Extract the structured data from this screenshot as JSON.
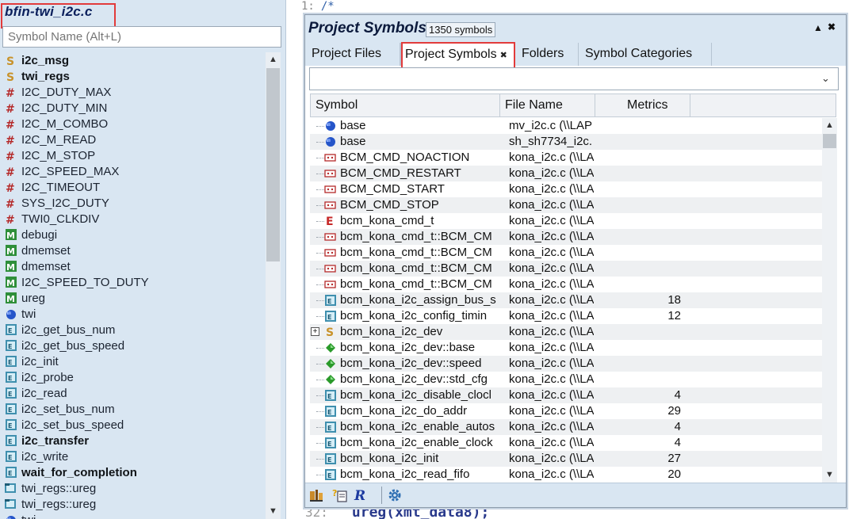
{
  "left": {
    "file_title": "bfin-twi_i2c.c",
    "search_placeholder": "Symbol Name (Alt+L)",
    "items": [
      {
        "label": "i2c_msg",
        "icon": "struct-icon",
        "bold": true
      },
      {
        "label": "twi_regs",
        "icon": "struct-icon",
        "bold": true
      },
      {
        "label": "I2C_DUTY_MAX",
        "icon": "macro-constant-icon",
        "bold": false
      },
      {
        "label": "I2C_DUTY_MIN",
        "icon": "macro-constant-icon",
        "bold": false
      },
      {
        "label": "I2C_M_COMBO",
        "icon": "macro-constant-icon",
        "bold": false
      },
      {
        "label": "I2C_M_READ",
        "icon": "macro-constant-icon",
        "bold": false
      },
      {
        "label": "I2C_M_STOP",
        "icon": "macro-constant-icon",
        "bold": false
      },
      {
        "label": "I2C_SPEED_MAX",
        "icon": "macro-constant-icon",
        "bold": false
      },
      {
        "label": "I2C_TIMEOUT",
        "icon": "macro-constant-icon",
        "bold": false
      },
      {
        "label": "SYS_I2C_DUTY",
        "icon": "macro-constant-icon",
        "bold": false
      },
      {
        "label": "TWI0_CLKDIV",
        "icon": "macro-constant-icon",
        "bold": false
      },
      {
        "label": "debugi",
        "icon": "macro-function-icon",
        "bold": false
      },
      {
        "label": "dmemset",
        "icon": "macro-function-icon",
        "bold": false
      },
      {
        "label": "dmemset",
        "icon": "macro-function-icon",
        "bold": false
      },
      {
        "label": "I2C_SPEED_TO_DUTY",
        "icon": "macro-function-icon",
        "bold": false
      },
      {
        "label": "ureg",
        "icon": "macro-function-icon",
        "bold": false
      },
      {
        "label": "twi",
        "icon": "global-variable-icon",
        "bold": false
      },
      {
        "label": "i2c_get_bus_num",
        "icon": "function-icon",
        "bold": false
      },
      {
        "label": "i2c_get_bus_speed",
        "icon": "function-icon",
        "bold": false
      },
      {
        "label": "i2c_init",
        "icon": "function-icon",
        "bold": false
      },
      {
        "label": "i2c_probe",
        "icon": "function-icon",
        "bold": false
      },
      {
        "label": "i2c_read",
        "icon": "function-icon",
        "bold": false
      },
      {
        "label": "i2c_set_bus_num",
        "icon": "function-icon",
        "bold": false
      },
      {
        "label": "i2c_set_bus_speed",
        "icon": "function-icon",
        "bold": false
      },
      {
        "label": "i2c_transfer",
        "icon": "function-icon",
        "bold": true
      },
      {
        "label": "i2c_write",
        "icon": "function-icon",
        "bold": false
      },
      {
        "label": "wait_for_completion",
        "icon": "function-icon",
        "bold": true
      },
      {
        "label": "twi_regs::ureg",
        "icon": "member-function-icon",
        "bold": false
      },
      {
        "label": "twi_regs::ureg",
        "icon": "member-function-icon",
        "bold": false
      },
      {
        "label": "twi",
        "icon": "global-variable-icon",
        "bold": false
      }
    ]
  },
  "editor": {
    "line1_number": "1:",
    "line1_text": "/*",
    "bottom_line_number": "32:",
    "bottom_text": "ureg(xmt_data8);"
  },
  "project": {
    "title": "Project Symbols",
    "count": "1350 symbols",
    "pin_label": "▲",
    "close_label": "✖",
    "tabs": [
      {
        "label": "Project Files",
        "active": false
      },
      {
        "label": "Project Symbols",
        "active": true,
        "close": "✖"
      },
      {
        "label": "Folders",
        "active": false
      },
      {
        "label": "Symbol Categories",
        "active": false
      }
    ],
    "filter_value": "",
    "filter_arrow": "⌄",
    "columns": [
      "Symbol",
      "File Name",
      "Metrics"
    ],
    "rows": [
      {
        "sym": "base",
        "file": "mv_i2c.c (\\\\LAP",
        "met": "",
        "icon": "global-variable-icon",
        "expand": false
      },
      {
        "sym": "base",
        "file": "sh_sh7734_i2c.",
        "met": "",
        "icon": "global-variable-icon",
        "expand": false
      },
      {
        "sym": "BCM_CMD_NOACTION",
        "file": "kona_i2c.c (\\\\LA",
        "met": "",
        "icon": "enum-constant-icon",
        "expand": false
      },
      {
        "sym": "BCM_CMD_RESTART",
        "file": "kona_i2c.c (\\\\LA",
        "met": "",
        "icon": "enum-constant-icon",
        "expand": false
      },
      {
        "sym": "BCM_CMD_START",
        "file": "kona_i2c.c (\\\\LA",
        "met": "",
        "icon": "enum-constant-icon",
        "expand": false
      },
      {
        "sym": "BCM_CMD_STOP",
        "file": "kona_i2c.c (\\\\LA",
        "met": "",
        "icon": "enum-constant-icon",
        "expand": false
      },
      {
        "sym": "bcm_kona_cmd_t",
        "file": "kona_i2c.c (\\\\LA",
        "met": "",
        "icon": "enum-icon",
        "expand": false
      },
      {
        "sym": "bcm_kona_cmd_t::BCM_CM",
        "file": "kona_i2c.c (\\\\LA",
        "met": "",
        "icon": "enum-constant-icon",
        "expand": false
      },
      {
        "sym": "bcm_kona_cmd_t::BCM_CM",
        "file": "kona_i2c.c (\\\\LA",
        "met": "",
        "icon": "enum-constant-icon",
        "expand": false
      },
      {
        "sym": "bcm_kona_cmd_t::BCM_CM",
        "file": "kona_i2c.c (\\\\LA",
        "met": "",
        "icon": "enum-constant-icon",
        "expand": false
      },
      {
        "sym": "bcm_kona_cmd_t::BCM_CM",
        "file": "kona_i2c.c (\\\\LA",
        "met": "",
        "icon": "enum-constant-icon",
        "expand": false
      },
      {
        "sym": "bcm_kona_i2c_assign_bus_s",
        "file": "kona_i2c.c (\\\\LA",
        "met": "18",
        "icon": "function-icon",
        "expand": false
      },
      {
        "sym": "bcm_kona_i2c_config_timin",
        "file": "kona_i2c.c (\\\\LA",
        "met": "12",
        "icon": "function-icon",
        "expand": false
      },
      {
        "sym": "bcm_kona_i2c_dev",
        "file": "kona_i2c.c (\\\\LA",
        "met": "",
        "icon": "struct-icon",
        "expand": true
      },
      {
        "sym": "bcm_kona_i2c_dev::base",
        "file": "kona_i2c.c (\\\\LA",
        "met": "",
        "icon": "field-icon",
        "expand": false
      },
      {
        "sym": "bcm_kona_i2c_dev::speed",
        "file": "kona_i2c.c (\\\\LA",
        "met": "",
        "icon": "field-icon",
        "expand": false
      },
      {
        "sym": "bcm_kona_i2c_dev::std_cfg",
        "file": "kona_i2c.c (\\\\LA",
        "met": "",
        "icon": "field-icon",
        "expand": false
      },
      {
        "sym": "bcm_kona_i2c_disable_clocl",
        "file": "kona_i2c.c (\\\\LA",
        "met": "4",
        "icon": "function-icon",
        "expand": false
      },
      {
        "sym": "bcm_kona_i2c_do_addr",
        "file": "kona_i2c.c (\\\\LA",
        "met": "29",
        "icon": "function-icon",
        "expand": false
      },
      {
        "sym": "bcm_kona_i2c_enable_autos",
        "file": "kona_i2c.c (\\\\LA",
        "met": "4",
        "icon": "function-icon",
        "expand": false
      },
      {
        "sym": "bcm_kona_i2c_enable_clock",
        "file": "kona_i2c.c (\\\\LA",
        "met": "4",
        "icon": "function-icon",
        "expand": false
      },
      {
        "sym": "bcm_kona_i2c_init",
        "file": "kona_i2c.c (\\\\LA",
        "met": "27",
        "icon": "function-icon",
        "expand": false
      },
      {
        "sym": "bcm_kona_i2c_read_fifo",
        "file": "kona_i2c.c (\\\\LA",
        "met": "20",
        "icon": "function-icon",
        "expand": false
      }
    ],
    "footer": [
      {
        "name": "symbol-browser-icon"
      },
      {
        "name": "lookup-references-icon"
      },
      {
        "name": "regex-icon"
      },
      {
        "name": "settings-gear-icon"
      }
    ]
  },
  "colors": {
    "highlight": "#e23b3b",
    "panel_bg": "#d9e6f2"
  }
}
